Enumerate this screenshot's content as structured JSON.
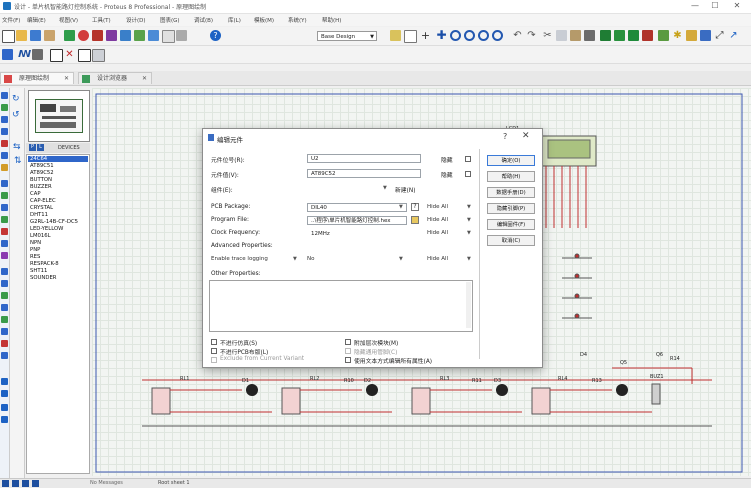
{
  "window": {
    "title": "设计 - 单片机智能路灯控制系统 - Proteus 8 Professional - 原理图绘制",
    "min": "—",
    "max": "☐",
    "close": "✕"
  },
  "menu": [
    "文件(F)",
    "编辑(E)",
    "视图(V)",
    "工具(T)",
    "设计(D)",
    "图表(G)",
    "调试(B)",
    "库(L)",
    "模板(M)",
    "系统(Y)",
    "帮助(H)"
  ],
  "toolbar": {
    "design_combo": "Base Design"
  },
  "tabs": [
    {
      "label": "原理图绘制",
      "close": "✕"
    },
    {
      "label": "设计浏览器",
      "close": "✕"
    }
  ],
  "device_panel": {
    "p_label": "P",
    "l_label": "L",
    "header": "DEVICES",
    "items": [
      "24C64",
      "AT89C51",
      "AT89C52",
      "BUTTON",
      "BUZZER",
      "CAP",
      "CAP-ELEC",
      "CRYSTAL",
      "DHT11",
      "G2RL-14B-CF-DC5",
      "LED-YELLOW",
      "LM016L",
      "NPN",
      "PNP",
      "RES",
      "RESPACK-8",
      "SHT11",
      "SOUNDER"
    ],
    "selected_index": 0
  },
  "status_bar": {
    "left": "No Messages",
    "middle": "Root sheet 1"
  },
  "dialog": {
    "title": "编辑元件",
    "help": "?",
    "close": "✕",
    "fields": {
      "ref_label": "元件位号(R):",
      "ref_value": "U2",
      "ref_hidden": "隐藏",
      "value_label": "元件值(V):",
      "value_value": "AT89C52",
      "value_hidden": "隐藏",
      "group_label": "组件(E):",
      "new_button": "新建(N)",
      "pcb_label": "PCB Package:",
      "pcb_value": "DIL40",
      "pcb_hide": "Hide All",
      "program_label": "Program File:",
      "program_value": "..\\程序\\单片机智能路灯控制.hex",
      "program_hide": "Hide All",
      "clock_label": "Clock Frequency:",
      "clock_value": "12MHz",
      "clock_hide": "Hide All",
      "advanced_label": "Advanced Properties:",
      "trace_label": "Enable trace logging",
      "trace_value": "No",
      "trace_hide": "Hide All",
      "other_label": "Other Properties:"
    },
    "checkboxes": [
      "不进行仿真(S)",
      "不进行PCB布版(L)",
      "Exclude from Current Variant",
      "附加层次模块(M)",
      "隐藏通用管脚(C)",
      "使用文本方式编辑所有属性(A)"
    ],
    "buttons": [
      "确定(O)",
      "帮助(H)",
      "数据手册(D)",
      "隐藏引脚(P)",
      "编辑固件(F)",
      "取消(C)"
    ]
  },
  "schematic_labels": {
    "lcd": "LCD1",
    "rl1": "RL1",
    "rl2": "RL2",
    "rl3": "RL3",
    "rl4": "RL4",
    "r10": "R10",
    "r11": "R11",
    "r12": "R12",
    "r13": "R13",
    "r14": "R14",
    "q5": "Q5",
    "q6": "Q6",
    "d1": "D1",
    "d2": "D2",
    "d3": "D3",
    "d4": "D4",
    "buzzer": "BUZ1"
  }
}
